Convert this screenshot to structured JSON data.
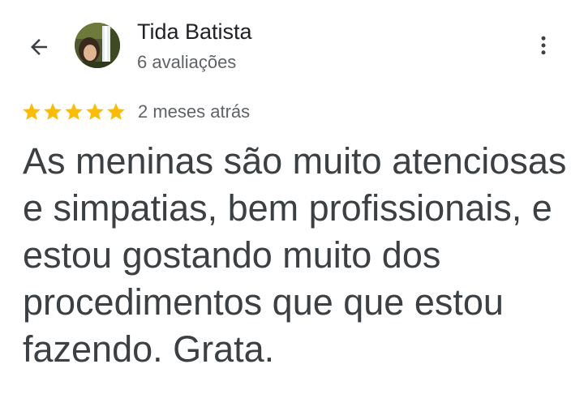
{
  "header": {
    "back_icon": "arrow-left-icon",
    "more_icon": "more-vertical-icon"
  },
  "reviewer": {
    "name": "Tida Batista",
    "review_count": "6 avaliações",
    "avatar": "waterfall-photo"
  },
  "review": {
    "rating": 5,
    "rating_max": 5,
    "star_color": "#fbbc04",
    "date": "2 meses atrás",
    "text": "As meninas são muito atenciosas e simpatias, bem profissionais, e estou gostando muito dos procedimentos que que estou fazendo. Grata."
  }
}
